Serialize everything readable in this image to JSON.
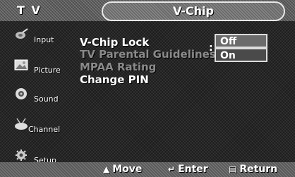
{
  "header": {
    "source_label": "T V",
    "title": "V-Chip"
  },
  "sidebar": {
    "items": [
      {
        "label": "Input",
        "icon": "input-icon"
      },
      {
        "label": "Picture",
        "icon": "picture-icon"
      },
      {
        "label": "Sound",
        "icon": "sound-icon"
      },
      {
        "label": "Channel",
        "icon": "channel-icon"
      },
      {
        "label": "Setup",
        "icon": "setup-icon"
      }
    ]
  },
  "menu": {
    "items": [
      {
        "label": "V-Chip Lock",
        "state": "enabled"
      },
      {
        "label": "TV Parental Guidelines",
        "state": "disabled"
      },
      {
        "label": "MPAA Rating",
        "state": "disabled"
      },
      {
        "label": "Change PIN",
        "state": "enabled"
      }
    ],
    "separator": ":",
    "dropdown": {
      "options": [
        "Off",
        "On"
      ],
      "selected": "Off"
    }
  },
  "footer": {
    "move": {
      "icon": "updown-arrow-icon",
      "label": "Move"
    },
    "enter": {
      "icon": "enter-icon",
      "label": "Enter"
    },
    "return": {
      "icon": "return-icon",
      "label": "Return"
    }
  },
  "colors": {
    "highlight": "#6b6b6b",
    "disabled_text": "#8a8a8a"
  }
}
